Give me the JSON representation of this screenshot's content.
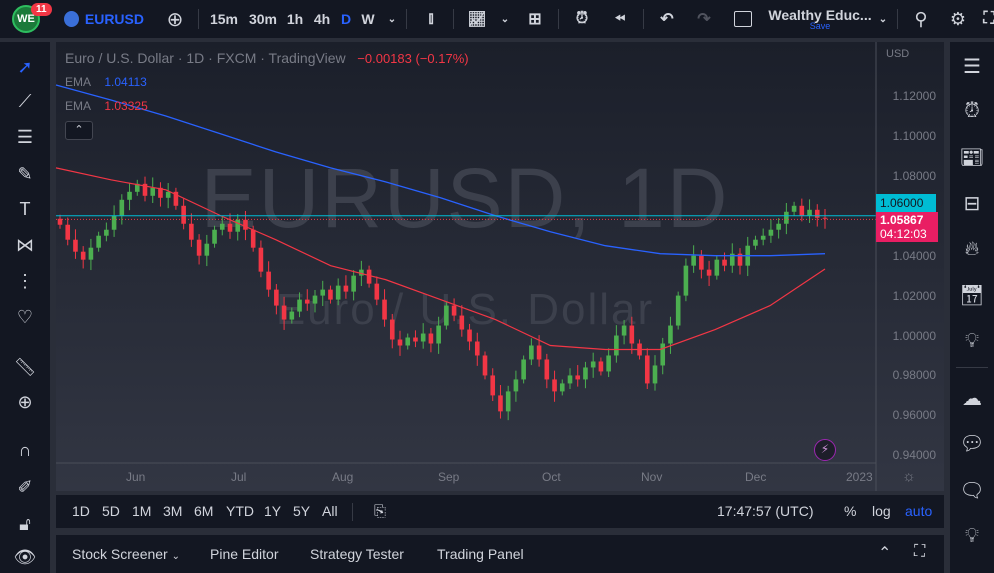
{
  "topbar": {
    "notifications": "11",
    "symbol": "EURUSD",
    "intervals": [
      "15m",
      "30m",
      "1h",
      "4h",
      "D",
      "W"
    ],
    "active_interval": "D",
    "layout_name": "Wealthy Educ...",
    "save_label": "Save"
  },
  "legend": {
    "title": "Euro / U.S. Dollar · 1D · FXCM · TradingView",
    "change": "−0.00183 (−0.17%)",
    "ema1_label": "EMA",
    "ema1_value": "1.04113",
    "ema2_label": "EMA",
    "ema2_value": "1.03325"
  },
  "watermark": {
    "line1": "EURUSD, 1D",
    "line2": "Euro / U.S. Dollar"
  },
  "price_axis": {
    "currency": "USD",
    "labels": [
      "1.12000",
      "1.10000",
      "1.08000",
      "1.06000",
      "1.04000",
      "1.02000",
      "1.00000",
      "0.98000",
      "0.96000",
      "0.94000"
    ],
    "highlight_label": "1.06000",
    "last_price": "1.05867",
    "countdown": "04:12:03"
  },
  "colors": {
    "up": "#26a69a",
    "up_candle": "#4caf50",
    "down": "#f23645",
    "ema_blue": "#2962ff",
    "ema_red": "#f23645",
    "accent": "#2962ff",
    "price_badge": "#e91e63",
    "level_badge": "#00bcd4"
  },
  "chart_data": {
    "type": "candlestick",
    "title": "Euro / U.S. Dollar · 1D · FXCM",
    "ylim": [
      0.93,
      1.13
    ],
    "x_ticks": [
      "Jun",
      "Jul",
      "Aug",
      "Sep",
      "Oct",
      "Nov",
      "Dec",
      "2023"
    ],
    "closes": [
      1.0555,
      1.048,
      1.042,
      1.038,
      1.044,
      1.05,
      1.053,
      1.06,
      1.068,
      1.072,
      1.076,
      1.07,
      1.074,
      1.069,
      1.072,
      1.065,
      1.056,
      1.048,
      1.04,
      1.046,
      1.053,
      1.056,
      1.052,
      1.058,
      1.053,
      1.044,
      1.032,
      1.023,
      1.015,
      1.008,
      1.012,
      1.018,
      1.016,
      1.02,
      1.023,
      1.018,
      1.025,
      1.022,
      1.03,
      1.033,
      1.026,
      1.018,
      1.008,
      0.998,
      0.995,
      0.999,
      0.997,
      1.001,
      0.996,
      1.005,
      1.015,
      1.01,
      1.003,
      0.997,
      0.99,
      0.98,
      0.97,
      0.962,
      0.972,
      0.978,
      0.988,
      0.995,
      0.988,
      0.978,
      0.972,
      0.976,
      0.98,
      0.978,
      0.984,
      0.987,
      0.982,
      0.99,
      1.0,
      1.005,
      0.996,
      0.99,
      0.976,
      0.985,
      0.996,
      1.005,
      1.02,
      1.035,
      1.04,
      1.033,
      1.03,
      1.038,
      1.035,
      1.041,
      1.035,
      1.045,
      1.048,
      1.05,
      1.053,
      1.056,
      1.062,
      1.065,
      1.06,
      1.063,
      1.059,
      1.0587
    ],
    "ema_blue": [
      1.1255,
      1.118,
      1.11,
      1.101,
      1.092,
      1.084,
      1.077,
      1.069,
      1.06,
      1.052,
      1.045,
      1.041,
      1.04,
      1.04,
      1.041
    ],
    "ema_red": [
      1.084,
      1.078,
      1.073,
      1.06,
      1.048,
      1.035,
      1.028,
      1.018,
      1.008,
      0.995,
      0.993,
      0.993,
      1.003,
      1.015,
      1.0333
    ],
    "horizontal_level": 1.06,
    "last_price": 1.05867
  },
  "timeframes": {
    "ranges": [
      "1D",
      "5D",
      "1M",
      "3M",
      "6M",
      "YTD",
      "1Y",
      "5Y",
      "All"
    ],
    "clock": "17:47:57 (UTC)",
    "percent": "%",
    "log": "log",
    "auto": "auto"
  },
  "bottom": {
    "tabs": [
      "Stock Screener",
      "Pine Editor",
      "Strategy Tester",
      "Trading Panel"
    ]
  }
}
